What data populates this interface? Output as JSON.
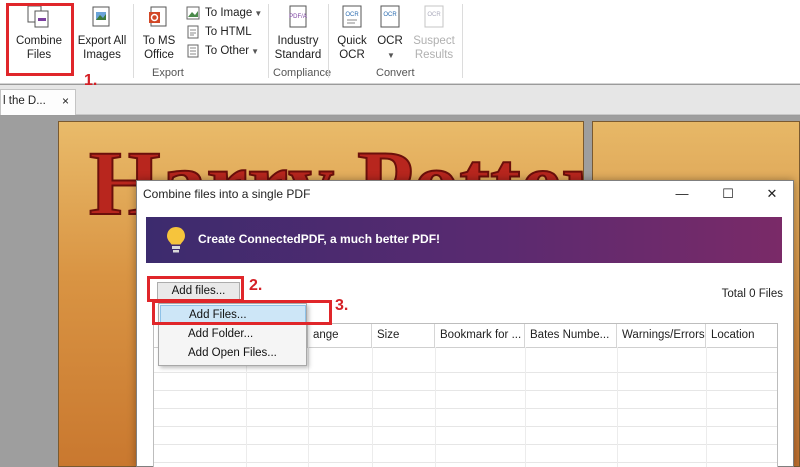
{
  "ribbon": {
    "combine_files": "Combine\nFiles",
    "export_all_images": "Export All\nImages",
    "to_ms_office": "To MS\nOffice",
    "to_image": "To Image",
    "to_html": "To HTML",
    "to_other": "To Other",
    "group_export": "Export",
    "industry_standard": "Industry\nStandard",
    "group_compliance": "Compliance",
    "quick_ocr": "Quick\nOCR",
    "ocr": "OCR",
    "suspect_results": "Suspect\nResults",
    "group_convert": "Convert",
    "icon_pdfa_label": "PDF/A",
    "icon_ocr_label": "OCR"
  },
  "tab": {
    "label": "l the D...",
    "close": "×"
  },
  "cover": {
    "title": "Harry Potter"
  },
  "dialog": {
    "title": "Combine files into a single PDF",
    "minimize": "—",
    "maximize": "☐",
    "close": "✕",
    "banner": "Create ConnectedPDF, a much better PDF!",
    "add_files_button": "Add files...",
    "total_files": "Total 0 Files",
    "columns": [
      "",
      "",
      "ange",
      "Size",
      "Bookmark for ...",
      "Bates Numbe...",
      "Warnings/Errors",
      "Location"
    ]
  },
  "menu": {
    "items": [
      "Add Files...",
      "Add Folder...",
      "Add Open Files..."
    ]
  },
  "annotations": {
    "step1": "1.",
    "step2": "2.",
    "step3": "3."
  },
  "colors": {
    "highlight": "#e0262a",
    "banner_start": "#3c2b6e",
    "banner_end": "#7a2a68",
    "menu_selected": "#cde6f7"
  }
}
